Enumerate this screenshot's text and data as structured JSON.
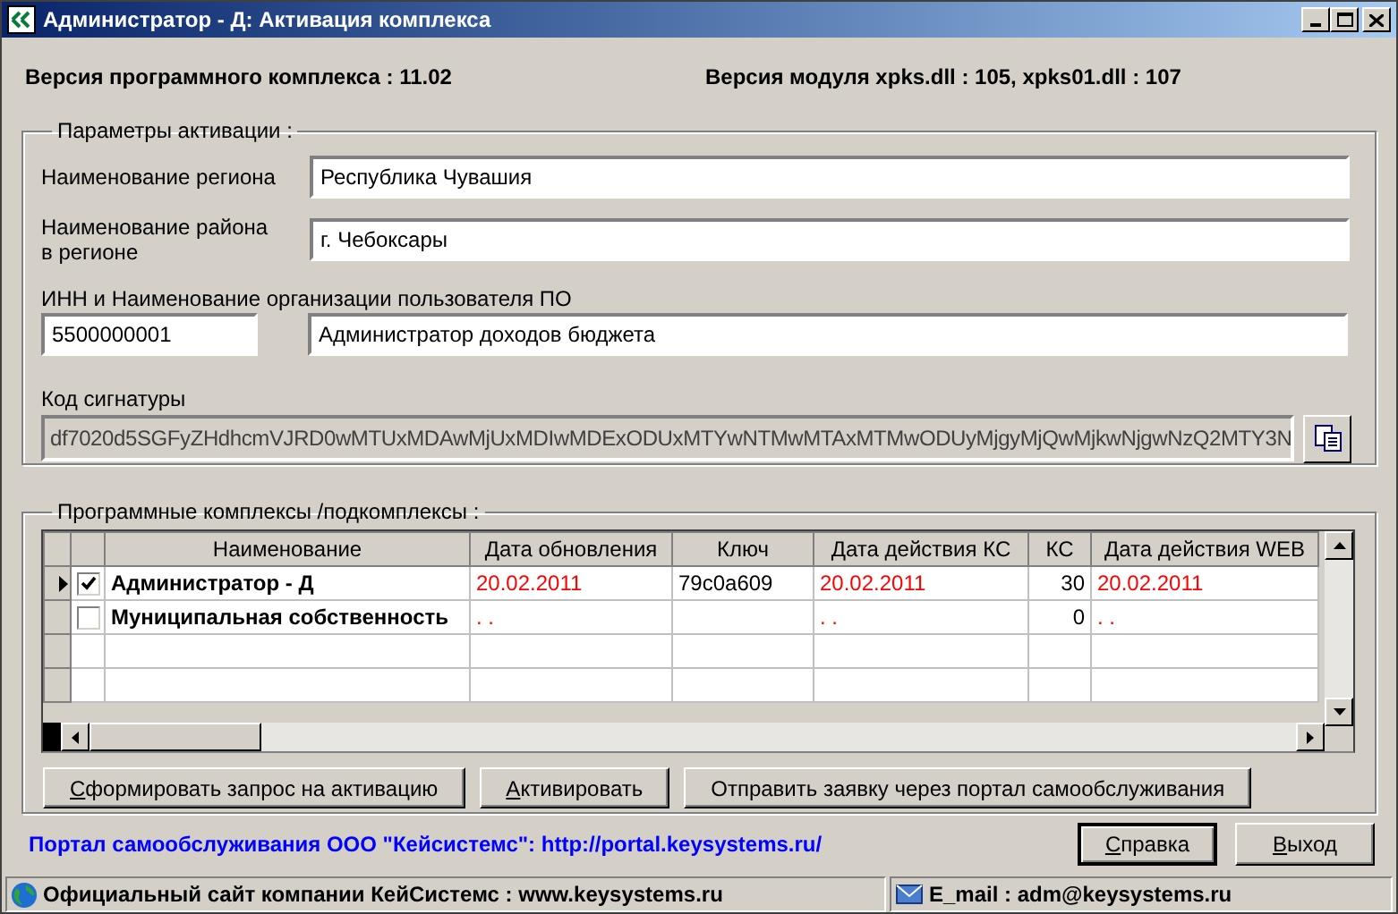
{
  "window": {
    "title": "Администратор - Д: Активация комплекса"
  },
  "versions": [
    "Версия программного комплекса : 11.02",
    "Версия модуля xpks.dll : 105, xpks01.dll : 107"
  ],
  "activation": {
    "title": "Параметры активации :",
    "region": {
      "label": "Наименование региона",
      "value": "Республика Чувашия"
    },
    "district": {
      "label": "Наименование района в регионе",
      "value": "г. Чебоксары"
    },
    "org": {
      "label": "ИНН и Наименование организации пользователя ПО",
      "inn": "5500000001",
      "name": "Администратор доходов бюджета"
    },
    "signature": {
      "label": "Код сигнатуры",
      "value": "df7020d5SGFyZHdhcmVJRD0wMTUxMDAwMjUxMDIwMDExODUxMTYwNTMwMTAxMTMwODUyMjgyMjQwMjkwNjgwNzQ2MTY3N"
    }
  },
  "complexes": {
    "title": "Программные комплексы /подкомплексы :",
    "columns": [
      "Наименование",
      "Дата обновления",
      "Ключ",
      "Дата действия КС",
      "КС",
      "Дата действия WEB"
    ],
    "rows": [
      {
        "selected": true,
        "checked": true,
        "cells": [
          "Администратор - Д",
          "20.02.2011",
          "79c0a609",
          "20.02.2011",
          "30",
          "20.02.2011"
        ]
      },
      {
        "selected": false,
        "checked": false,
        "cells": [
          "Муниципальная собственность",
          ". .",
          "",
          ". .",
          "0",
          ". ."
        ]
      }
    ]
  },
  "actions": [
    {
      "label": "Сформировать запрос на активацию",
      "underline_first": true
    },
    {
      "label": "Активировать",
      "underline_first": true
    },
    {
      "label": "Отправить заявку через портал самообслуживания",
      "underline_first": false
    }
  ],
  "portal_link": "Портал самообслуживания ООО \"Кейсистемс\": http://portal.keysystems.ru/",
  "dialog_buttons": [
    {
      "label": "Справка",
      "underline_first": true,
      "default": true
    },
    {
      "label": "Выход",
      "underline_first": true,
      "default": false
    }
  ],
  "status_bar": [
    "Официальный сайт компании КейСистемс : www.keysystems.ru",
    "E_mail : adm@keysystems.ru"
  ]
}
